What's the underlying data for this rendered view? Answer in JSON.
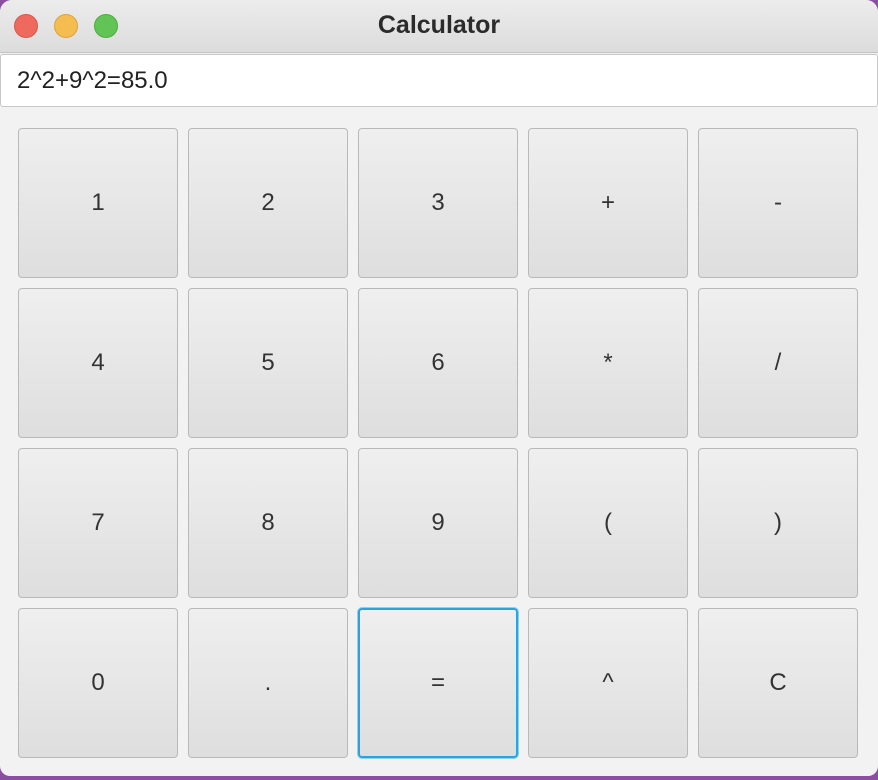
{
  "window": {
    "title": "Calculator"
  },
  "display": {
    "value": "2^2+9^2=85.0"
  },
  "keypad": {
    "keys": [
      {
        "label": "1",
        "name": "key-1"
      },
      {
        "label": "2",
        "name": "key-2"
      },
      {
        "label": "3",
        "name": "key-3"
      },
      {
        "label": "+",
        "name": "key-plus"
      },
      {
        "label": "-",
        "name": "key-minus"
      },
      {
        "label": "4",
        "name": "key-4"
      },
      {
        "label": "5",
        "name": "key-5"
      },
      {
        "label": "6",
        "name": "key-6"
      },
      {
        "label": "*",
        "name": "key-multiply"
      },
      {
        "label": "/",
        "name": "key-divide"
      },
      {
        "label": "7",
        "name": "key-7"
      },
      {
        "label": "8",
        "name": "key-8"
      },
      {
        "label": "9",
        "name": "key-9"
      },
      {
        "label": "(",
        "name": "key-open-paren"
      },
      {
        "label": ")",
        "name": "key-close-paren"
      },
      {
        "label": "0",
        "name": "key-0"
      },
      {
        "label": ".",
        "name": "key-decimal"
      },
      {
        "label": "=",
        "name": "key-equals"
      },
      {
        "label": "^",
        "name": "key-power"
      },
      {
        "label": "C",
        "name": "key-clear"
      }
    ],
    "focused_key": "="
  },
  "colors": {
    "focus_ring": "#2aa3e0",
    "close": "#ee6a5e",
    "minimize": "#f5bd4f",
    "maximize": "#61c454"
  }
}
